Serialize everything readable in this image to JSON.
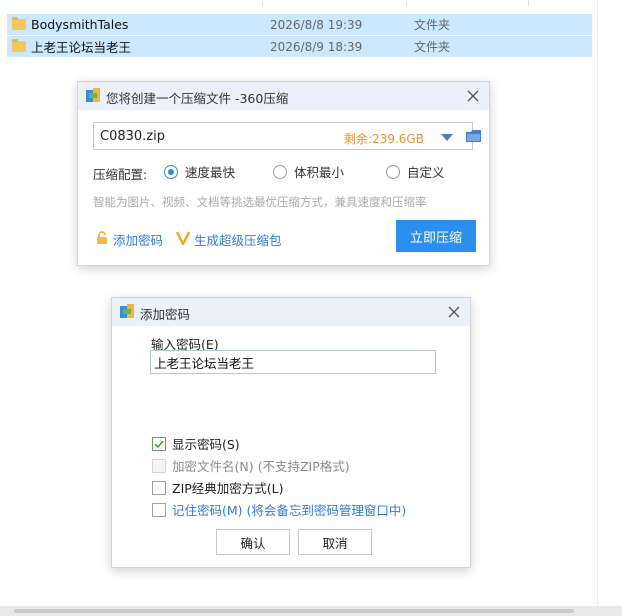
{
  "explorer": {
    "rows": [
      {
        "name": "BodysmithTales",
        "date": "2026/8/8 19:39",
        "type": "文件夹"
      },
      {
        "name": "上老王论坛当老王",
        "date": "2026/8/9 18:39",
        "type": "文件夹"
      }
    ]
  },
  "compress_dialog": {
    "title": "您将创建一个压缩文件 -360压缩",
    "filename": "C0830.zip",
    "free_space": "剩余:239.6GB",
    "config_label": "压缩配置:",
    "options": [
      {
        "label": "速度最快",
        "selected": true
      },
      {
        "label": "体积最小",
        "selected": false
      },
      {
        "label": "自定义",
        "selected": false
      }
    ],
    "hint": "智能为图片、视频、文档等挑选最优压缩方式，兼具速度和压缩率",
    "add_password_label": "添加密码",
    "super_compress_label": "生成超级压缩包",
    "compress_button": "立即压缩",
    "accent_color": "#2a8fee",
    "space_color": "#e8912e"
  },
  "password_dialog": {
    "title": "添加密码",
    "input_label": "输入密码(E)",
    "password_value": "上老王论坛当老王",
    "show_password": {
      "label": "显示密码(S)",
      "checked": true
    },
    "encrypt_filenames": {
      "label": "加密文件名(N) (不支持ZIP格式)",
      "checked": false,
      "disabled": true
    },
    "zip_classic": {
      "label": "ZIP经典加密方式(L)",
      "checked": false
    },
    "remember_password": {
      "label": "记住密码(M) (将会备忘到密码管理窗口中)",
      "checked": false
    },
    "ok_button": "确认",
    "cancel_button": "取消"
  }
}
